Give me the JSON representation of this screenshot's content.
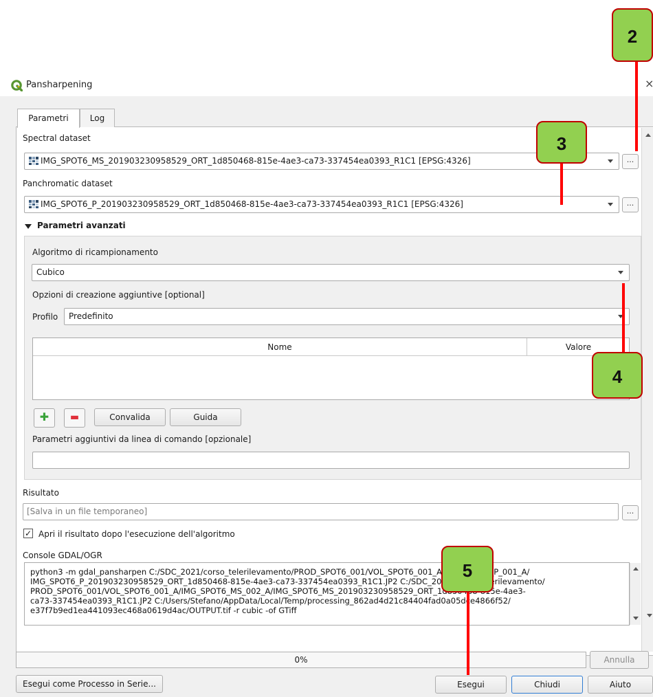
{
  "window": {
    "title": "Pansharpening",
    "close_glyph": "×",
    "icon": "qgis-logo-icon"
  },
  "tabs": [
    {
      "label": "Parametri",
      "active": true
    },
    {
      "label": "Log",
      "active": false
    }
  ],
  "spectral": {
    "label": "Spectral dataset",
    "value": "IMG_SPOT6_MS_201903230958529_ORT_1d850468-815e-4ae3-ca73-337454ea0393_R1C1 [EPSG:4326]",
    "browse": "..."
  },
  "panchromatic": {
    "label": "Panchromatic dataset",
    "value": "IMG_SPOT6_P_201903230958529_ORT_1d850468-815e-4ae3-ca73-337454ea0393_R1C1 [EPSG:4326]",
    "browse": "..."
  },
  "advanced": {
    "title": "Parametri avanzati",
    "resampling_label": "Algoritmo di ricampionamento",
    "resampling_value": "Cubico",
    "creation_options_label": "Opzioni di creazione aggiuntive [optional]",
    "profile_label": "Profilo",
    "profile_value": "Predefinito",
    "table_columns": [
      "Nome",
      "Valore"
    ],
    "add_glyph": "✚",
    "remove_glyph": "▬",
    "validate_label": "Convalida",
    "help_label": "Guida",
    "extra_params_label": "Parametri aggiuntivi da linea di comando [opzionale]",
    "extra_params_value": ""
  },
  "result": {
    "label": "Risultato",
    "placeholder": "[Salva in un file temporaneo]",
    "browse": "..."
  },
  "open_after": {
    "checked": true,
    "label": "Apri il risultato dopo l'esecuzione dell'algoritmo"
  },
  "console": {
    "label": "Console GDAL/OGR",
    "text": "python3 -m gdal_pansharpen C:/SDC_2021/corso_telerilevamento/PROD_SPOT6_001/VOL_SPOT6_001_A/IMG_SPOT6_P_001_A/\nIMG_SPOT6_P_201903230958529_ORT_1d850468-815e-4ae3-ca73-337454ea0393_R1C1.JP2 C:/SDC_2021/corso_telerilevamento/\nPROD_SPOT6_001/VOL_SPOT6_001_A/IMG_SPOT6_MS_002_A/IMG_SPOT6_MS_201903230958529_ORT_1d850468-815e-4ae3-\nca73-337454ea0393_R1C1.JP2 C:/Users/Stefano/AppData/Local/Temp/processing_862ad4d21c84404fad0a05dce4866f52/\ne37f7b9ed1ea441093ec468a0619d4ac/OUTPUT.tif -r cubic -of GTiff"
  },
  "progress": {
    "text": "0%",
    "value": 0
  },
  "buttons": {
    "cancel": "Annulla",
    "batch": "Esegui come Processo in Serie...",
    "run": "Esegui",
    "close": "Chiudi",
    "help": "Aiuto"
  },
  "callouts": [
    "2",
    "3",
    "4",
    "5"
  ],
  "colors": {
    "callout_fill": "#92d050",
    "callout_border": "#c00000",
    "pointer_line": "#ff0000",
    "qgis_green": "#589632"
  }
}
